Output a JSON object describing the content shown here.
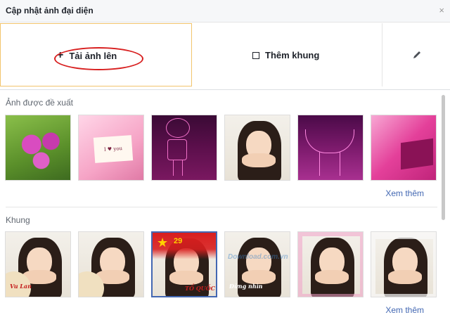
{
  "header": {
    "title": "Cập nhật ảnh đại diện",
    "close_label": "×"
  },
  "actions": {
    "upload_label": "Tải ảnh lên",
    "upload_icon": "plus-icon",
    "frame_label": "Thêm khung",
    "frame_icon": "frame-icon",
    "edit_icon": "pencil-icon"
  },
  "suggested": {
    "title": "Ảnh được đề xuất",
    "see_more": "Xem thêm",
    "love_card_text": "I ♥ you"
  },
  "frames": {
    "title": "Khung",
    "see_more": "Xem thêm",
    "frame1_text": "Vu Lan",
    "frame3_badge": "29",
    "frame3_text": "TỔ QUỐC",
    "frame4_text": "Đừng nhìn",
    "watermark_text": "Download.com.vn"
  },
  "colors": {
    "accent": "#4267b2",
    "upload_border": "#f2c46b",
    "annotation": "#d82020"
  }
}
